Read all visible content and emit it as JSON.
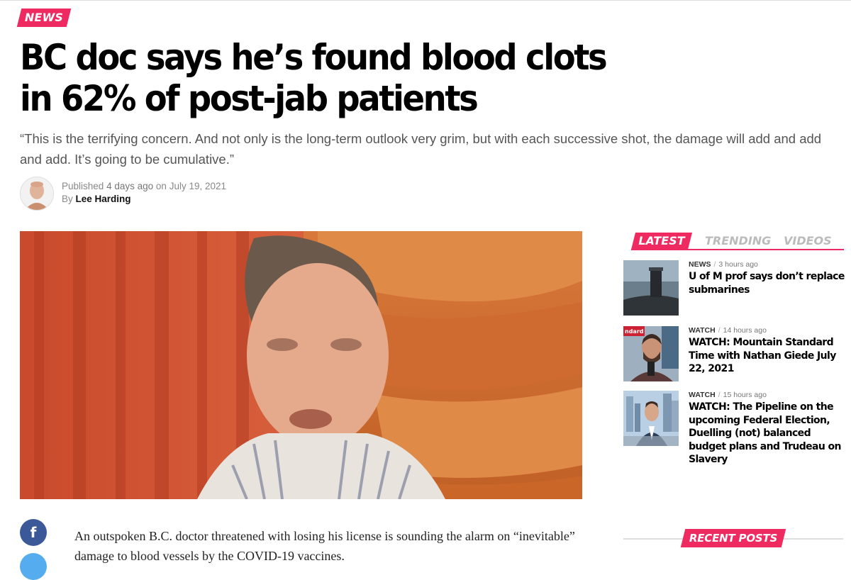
{
  "article": {
    "category": "NEWS",
    "headline": "BC doc says he’s found blood clots in 62% of post-jab patients",
    "subtitle": "“This is the terrifying concern. And not only is the long-term outlook very grim, but with each successive shot, the damage will add and add and add. It’s going to be cumulative.”",
    "published_label": "Published",
    "published_relative": "4 days ago",
    "published_on": "on",
    "published_date": "July 19, 2021",
    "by_label": "By",
    "author": "Lee Harding",
    "body_intro": "An outspoken B.C. doctor threatened with losing his license is sounding the alarm on “inevitable” damage to blood vessels by the COVID-19 vaccines."
  },
  "sidebar": {
    "tabs": [
      "LATEST",
      "TRENDING",
      "VIDEOS"
    ],
    "active_tab": "LATEST",
    "items": [
      {
        "category": "NEWS",
        "time": "3 hours ago",
        "title": "U of M prof says don’t replace submarines"
      },
      {
        "category": "WATCH",
        "time": "14 hours ago",
        "title": "WATCH: Mountain Standard Time with Nathan Giede July 22, 2021",
        "thumb_text": "ndard"
      },
      {
        "category": "WATCH",
        "time": "15 hours ago",
        "title": "WATCH: The Pipeline on the upcoming Federal Election, Duelling (not) balanced budget plans and Trudeau on Slavery"
      }
    ],
    "recent_posts_label": "RECENT POSTS"
  },
  "share": {
    "facebook_glyph": "f"
  },
  "colors": {
    "accent": "#ef2a61",
    "facebook": "#3b5998",
    "twitter": "#55acee"
  }
}
